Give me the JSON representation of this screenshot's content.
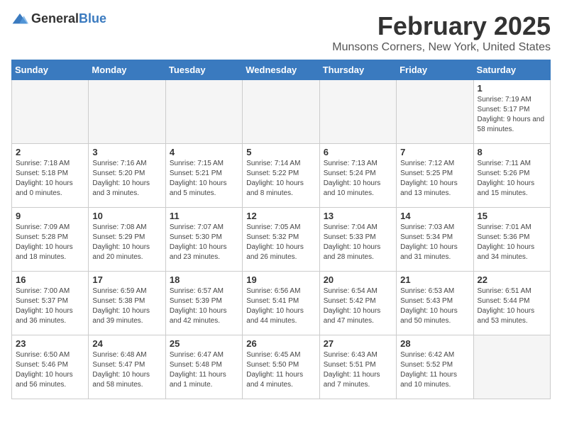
{
  "header": {
    "logo_general": "General",
    "logo_blue": "Blue",
    "month": "February 2025",
    "location": "Munsons Corners, New York, United States"
  },
  "weekdays": [
    "Sunday",
    "Monday",
    "Tuesday",
    "Wednesday",
    "Thursday",
    "Friday",
    "Saturday"
  ],
  "weeks": [
    [
      {
        "day": "",
        "info": ""
      },
      {
        "day": "",
        "info": ""
      },
      {
        "day": "",
        "info": ""
      },
      {
        "day": "",
        "info": ""
      },
      {
        "day": "",
        "info": ""
      },
      {
        "day": "",
        "info": ""
      },
      {
        "day": "1",
        "info": "Sunrise: 7:19 AM\nSunset: 5:17 PM\nDaylight: 9 hours and 58 minutes."
      }
    ],
    [
      {
        "day": "2",
        "info": "Sunrise: 7:18 AM\nSunset: 5:18 PM\nDaylight: 10 hours and 0 minutes."
      },
      {
        "day": "3",
        "info": "Sunrise: 7:16 AM\nSunset: 5:20 PM\nDaylight: 10 hours and 3 minutes."
      },
      {
        "day": "4",
        "info": "Sunrise: 7:15 AM\nSunset: 5:21 PM\nDaylight: 10 hours and 5 minutes."
      },
      {
        "day": "5",
        "info": "Sunrise: 7:14 AM\nSunset: 5:22 PM\nDaylight: 10 hours and 8 minutes."
      },
      {
        "day": "6",
        "info": "Sunrise: 7:13 AM\nSunset: 5:24 PM\nDaylight: 10 hours and 10 minutes."
      },
      {
        "day": "7",
        "info": "Sunrise: 7:12 AM\nSunset: 5:25 PM\nDaylight: 10 hours and 13 minutes."
      },
      {
        "day": "8",
        "info": "Sunrise: 7:11 AM\nSunset: 5:26 PM\nDaylight: 10 hours and 15 minutes."
      }
    ],
    [
      {
        "day": "9",
        "info": "Sunrise: 7:09 AM\nSunset: 5:28 PM\nDaylight: 10 hours and 18 minutes."
      },
      {
        "day": "10",
        "info": "Sunrise: 7:08 AM\nSunset: 5:29 PM\nDaylight: 10 hours and 20 minutes."
      },
      {
        "day": "11",
        "info": "Sunrise: 7:07 AM\nSunset: 5:30 PM\nDaylight: 10 hours and 23 minutes."
      },
      {
        "day": "12",
        "info": "Sunrise: 7:05 AM\nSunset: 5:32 PM\nDaylight: 10 hours and 26 minutes."
      },
      {
        "day": "13",
        "info": "Sunrise: 7:04 AM\nSunset: 5:33 PM\nDaylight: 10 hours and 28 minutes."
      },
      {
        "day": "14",
        "info": "Sunrise: 7:03 AM\nSunset: 5:34 PM\nDaylight: 10 hours and 31 minutes."
      },
      {
        "day": "15",
        "info": "Sunrise: 7:01 AM\nSunset: 5:36 PM\nDaylight: 10 hours and 34 minutes."
      }
    ],
    [
      {
        "day": "16",
        "info": "Sunrise: 7:00 AM\nSunset: 5:37 PM\nDaylight: 10 hours and 36 minutes."
      },
      {
        "day": "17",
        "info": "Sunrise: 6:59 AM\nSunset: 5:38 PM\nDaylight: 10 hours and 39 minutes."
      },
      {
        "day": "18",
        "info": "Sunrise: 6:57 AM\nSunset: 5:39 PM\nDaylight: 10 hours and 42 minutes."
      },
      {
        "day": "19",
        "info": "Sunrise: 6:56 AM\nSunset: 5:41 PM\nDaylight: 10 hours and 44 minutes."
      },
      {
        "day": "20",
        "info": "Sunrise: 6:54 AM\nSunset: 5:42 PM\nDaylight: 10 hours and 47 minutes."
      },
      {
        "day": "21",
        "info": "Sunrise: 6:53 AM\nSunset: 5:43 PM\nDaylight: 10 hours and 50 minutes."
      },
      {
        "day": "22",
        "info": "Sunrise: 6:51 AM\nSunset: 5:44 PM\nDaylight: 10 hours and 53 minutes."
      }
    ],
    [
      {
        "day": "23",
        "info": "Sunrise: 6:50 AM\nSunset: 5:46 PM\nDaylight: 10 hours and 56 minutes."
      },
      {
        "day": "24",
        "info": "Sunrise: 6:48 AM\nSunset: 5:47 PM\nDaylight: 10 hours and 58 minutes."
      },
      {
        "day": "25",
        "info": "Sunrise: 6:47 AM\nSunset: 5:48 PM\nDaylight: 11 hours and 1 minute."
      },
      {
        "day": "26",
        "info": "Sunrise: 6:45 AM\nSunset: 5:50 PM\nDaylight: 11 hours and 4 minutes."
      },
      {
        "day": "27",
        "info": "Sunrise: 6:43 AM\nSunset: 5:51 PM\nDaylight: 11 hours and 7 minutes."
      },
      {
        "day": "28",
        "info": "Sunrise: 6:42 AM\nSunset: 5:52 PM\nDaylight: 11 hours and 10 minutes."
      },
      {
        "day": "",
        "info": ""
      }
    ]
  ]
}
